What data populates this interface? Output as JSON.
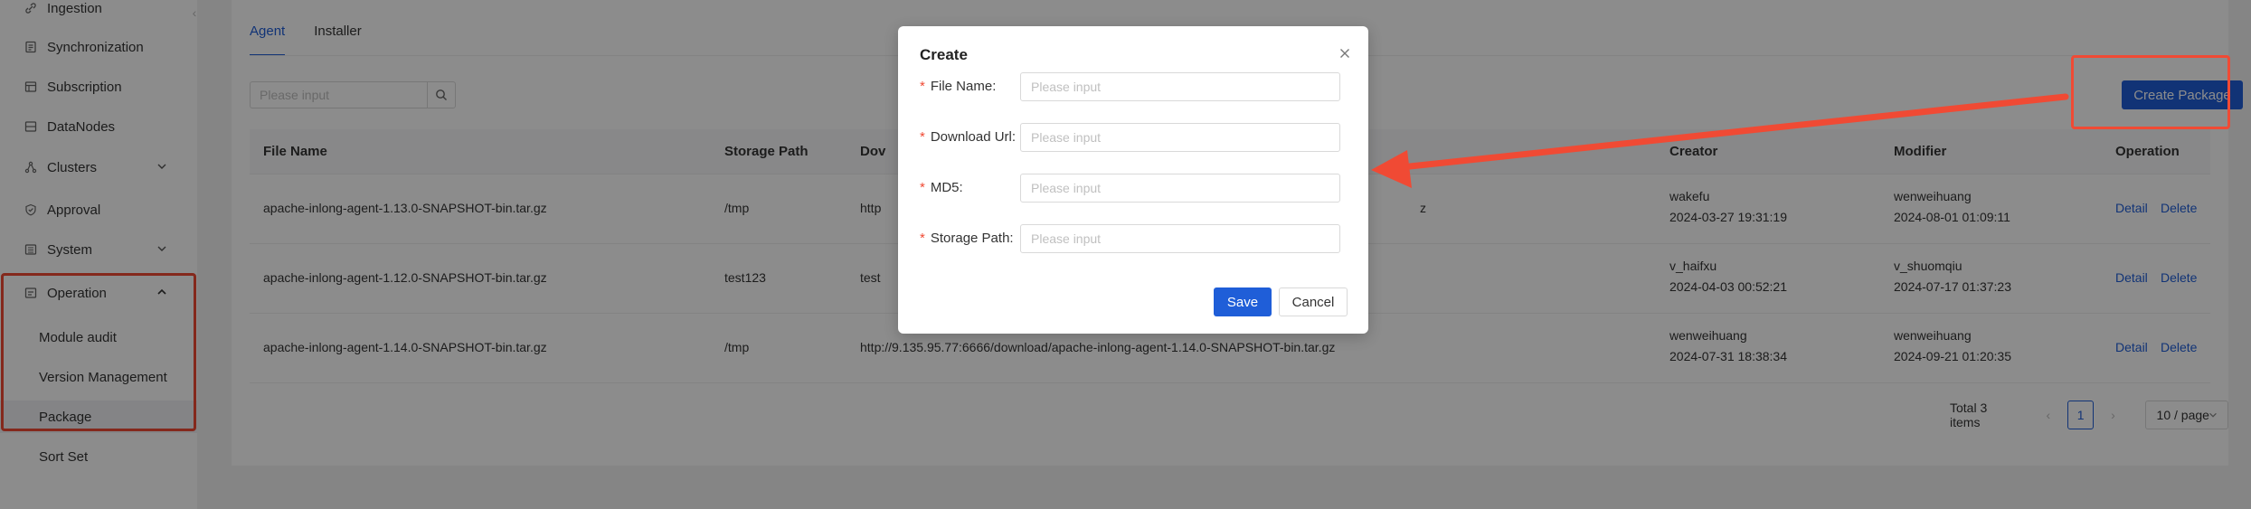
{
  "sidebar": {
    "items": [
      {
        "label": "Ingestion",
        "icon": "link-icon"
      },
      {
        "label": "Synchronization",
        "icon": "document-icon"
      },
      {
        "label": "Subscription",
        "icon": "subscription-icon"
      },
      {
        "label": "DataNodes",
        "icon": "datanodes-icon"
      },
      {
        "label": "Clusters",
        "icon": "clusters-icon"
      },
      {
        "label": "Approval",
        "icon": "shield-icon"
      },
      {
        "label": "System",
        "icon": "system-icon"
      },
      {
        "label": "Operation",
        "icon": "operation-icon"
      }
    ],
    "sub_items": [
      {
        "label": "Module audit"
      },
      {
        "label": "Version Management"
      },
      {
        "label": "Package"
      },
      {
        "label": "Sort Set"
      }
    ]
  },
  "tabs": [
    {
      "label": "Agent"
    },
    {
      "label": "Installer"
    }
  ],
  "search": {
    "placeholder": "Please input"
  },
  "toolbar": {
    "create_label": "Create Package"
  },
  "table": {
    "columns": [
      "File Name",
      "Storage Path",
      "Dov",
      "Creator",
      "Modifier",
      "Operation"
    ],
    "rows": [
      {
        "file_name": "apache-inlong-agent-1.13.0-SNAPSHOT-bin.tar.gz",
        "storage_path": "/tmp",
        "download_url": "http",
        "download_tail": "z",
        "creator": "wakefu",
        "created": "2024-03-27 19:31:19",
        "modifier": "wenweihuang",
        "modified": "2024-08-01 01:09:11"
      },
      {
        "file_name": "apache-inlong-agent-1.12.0-SNAPSHOT-bin.tar.gz",
        "storage_path": "test123",
        "download_url": "test",
        "download_tail": "",
        "creator": "v_haifxu",
        "created": "2024-04-03 00:52:21",
        "modifier": "v_shuomqiu",
        "modified": "2024-07-17 01:37:23"
      },
      {
        "file_name": "apache-inlong-agent-1.14.0-SNAPSHOT-bin.tar.gz",
        "storage_path": "/tmp",
        "download_url": "http://9.135.95.77:6666/download/apache-inlong-agent-1.14.0-SNAPSHOT-bin.tar.gz",
        "download_tail": "",
        "creator": "wenweihuang",
        "created": "2024-07-31 18:38:34",
        "modifier": "wenweihuang",
        "modified": "2024-09-21 01:20:35"
      }
    ],
    "detail_label": "Detail",
    "delete_label": "Delete"
  },
  "pagination": {
    "total": "Total 3 items",
    "current": "1",
    "page_size": "10 / page"
  },
  "modal": {
    "title": "Create",
    "fields": [
      {
        "label": "File Name",
        "colon": ":",
        "placeholder": "Please input"
      },
      {
        "label": "Download Url",
        "colon": ":",
        "placeholder": "Please input"
      },
      {
        "label": "MD5",
        "colon": ":",
        "placeholder": "Please input"
      },
      {
        "label": "Storage Path",
        "colon": ":",
        "placeholder": "Please input"
      }
    ],
    "required_mark": "*",
    "save_label": "Save",
    "cancel_label": "Cancel"
  },
  "colors": {
    "primary": "#1f5ed8",
    "annotation": "#f04a34"
  }
}
